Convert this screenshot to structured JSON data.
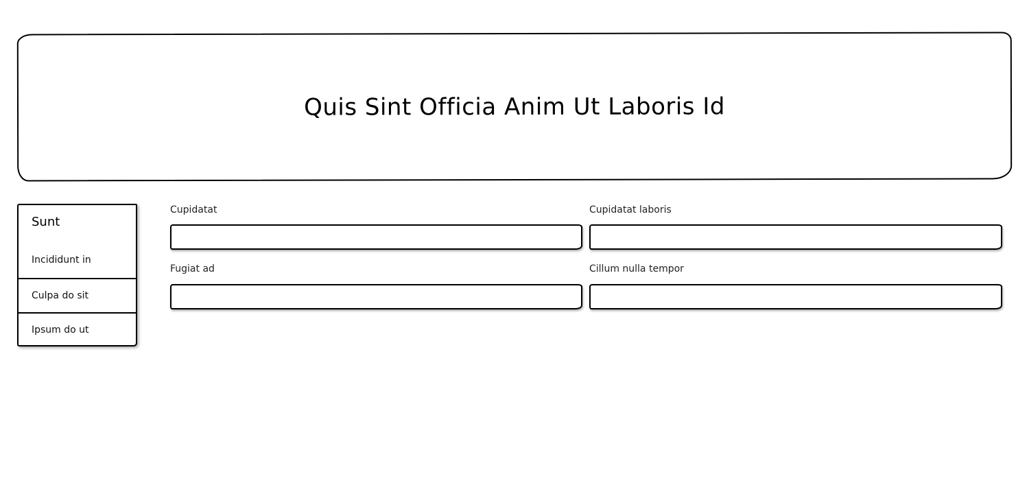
{
  "header": {
    "title": "Quis Sint Officia Anim Ut Laboris Id"
  },
  "sidebar": {
    "heading": "Sunt",
    "items": [
      {
        "label": "Incididunt in"
      },
      {
        "label": "Culpa do sit"
      },
      {
        "label": "Ipsum do ut"
      }
    ]
  },
  "form": {
    "fields": [
      {
        "label": "Cupidatat",
        "value": "",
        "placeholder": ""
      },
      {
        "label": "Cupidatat laboris",
        "value": "",
        "placeholder": ""
      },
      {
        "label": "Fugiat ad",
        "value": "",
        "placeholder": ""
      },
      {
        "label": "Cillum nulla tempor",
        "value": "",
        "placeholder": ""
      }
    ]
  }
}
